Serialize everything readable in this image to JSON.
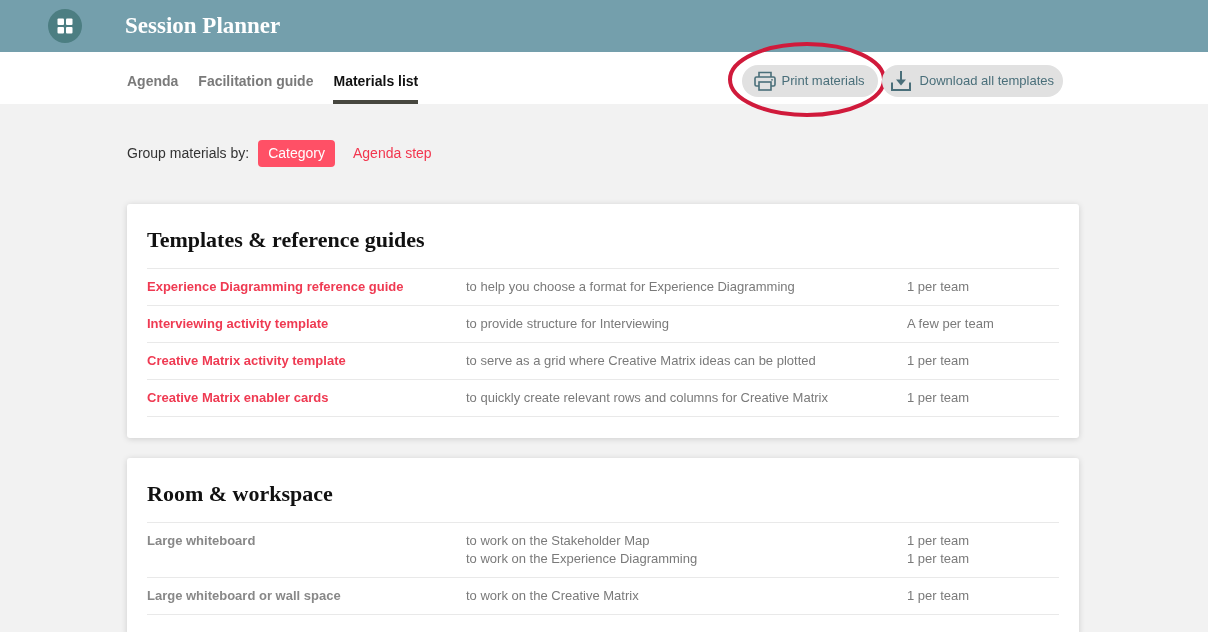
{
  "header": {
    "title": "Session Planner"
  },
  "tabs": [
    {
      "label": "Agenda",
      "selected": false
    },
    {
      "label": "Facilitation guide",
      "selected": false
    },
    {
      "label": "Materials list",
      "selected": true
    }
  ],
  "actions": [
    {
      "label": "Print materials",
      "kind": "print",
      "circled": true
    },
    {
      "label": "Download all templates",
      "kind": "download",
      "circled": false
    }
  ],
  "group_by": {
    "label": "Group materials by:",
    "options": [
      {
        "label": "Category",
        "selected": true
      },
      {
        "label": "Agenda step",
        "selected": false
      }
    ]
  },
  "sections": [
    {
      "title": "Templates & reference guides",
      "items": [
        {
          "name": "Experience Diagramming reference guide",
          "linked": true,
          "uses": [
            {
              "purpose": "to help you choose a format for Experience Diagramming",
              "quantity": "1 per team"
            }
          ]
        },
        {
          "name": "Interviewing activity template",
          "linked": true,
          "uses": [
            {
              "purpose": "to provide structure for Interviewing",
              "quantity": "A few per team"
            }
          ]
        },
        {
          "name": "Creative Matrix activity template",
          "linked": true,
          "uses": [
            {
              "purpose": "to serve as a grid where Creative Matrix ideas can be plotted",
              "quantity": "1 per team"
            }
          ]
        },
        {
          "name": "Creative Matrix enabler cards",
          "linked": true,
          "uses": [
            {
              "purpose": "to quickly create relevant rows and columns for Creative Matrix",
              "quantity": "1 per team"
            }
          ]
        }
      ]
    },
    {
      "title": "Room & workspace",
      "items": [
        {
          "name": "Large whiteboard",
          "linked": false,
          "uses": [
            {
              "purpose": "to work on the Stakeholder Map",
              "quantity": "1 per team"
            },
            {
              "purpose": "to work on the Experience Diagramming",
              "quantity": "1 per team"
            }
          ]
        },
        {
          "name": "Large whiteboard or wall space",
          "linked": false,
          "uses": [
            {
              "purpose": "to work on the Creative Matrix",
              "quantity": "1 per team"
            }
          ]
        }
      ]
    }
  ]
}
